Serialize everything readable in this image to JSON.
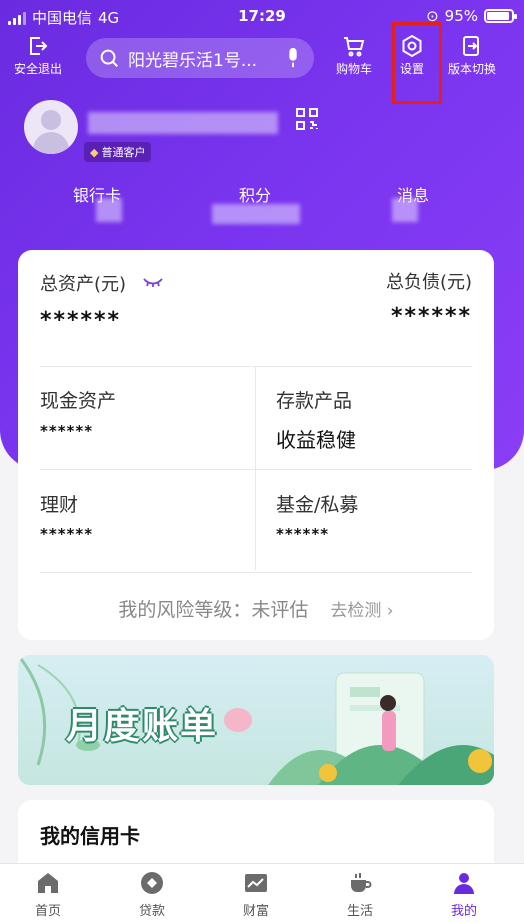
{
  "status_bar": {
    "carrier": "中国电信",
    "network": "4G",
    "time": "17:29",
    "battery": "95%"
  },
  "top_bar": {
    "logout_label": "安全退出",
    "search_placeholder": "阳光碧乐活1号...",
    "cart_label": "购物车",
    "settings_label": "设置",
    "switch_label": "版本切换"
  },
  "profile": {
    "badge": "普通客户"
  },
  "quick_links": [
    "银行卡",
    "积分",
    "消息"
  ],
  "assets": {
    "total_assets_label": "总资产(元)",
    "total_assets_value": "******",
    "total_debt_label": "总负债(元)",
    "total_debt_value": "******",
    "cells": [
      {
        "label": "现金资产",
        "value": "******"
      },
      {
        "label": "存款产品",
        "value": "收益稳健"
      },
      {
        "label": "理财",
        "value": "******"
      },
      {
        "label": "基金/私募",
        "value": "******"
      }
    ],
    "risk_label": "我的风险等级：未评估",
    "risk_link": "去检测"
  },
  "banner": {
    "title": "月度账单"
  },
  "credit_card": {
    "title": "我的信用卡"
  },
  "tabs": [
    {
      "label": "首页",
      "icon": "home-icon"
    },
    {
      "label": "贷款",
      "icon": "loan-icon"
    },
    {
      "label": "财富",
      "icon": "wealth-icon"
    },
    {
      "label": "生活",
      "icon": "life-icon"
    },
    {
      "label": "我的",
      "icon": "me-icon"
    }
  ],
  "colors": {
    "brand": "#6a2be0",
    "highlight": "#e5201b"
  }
}
